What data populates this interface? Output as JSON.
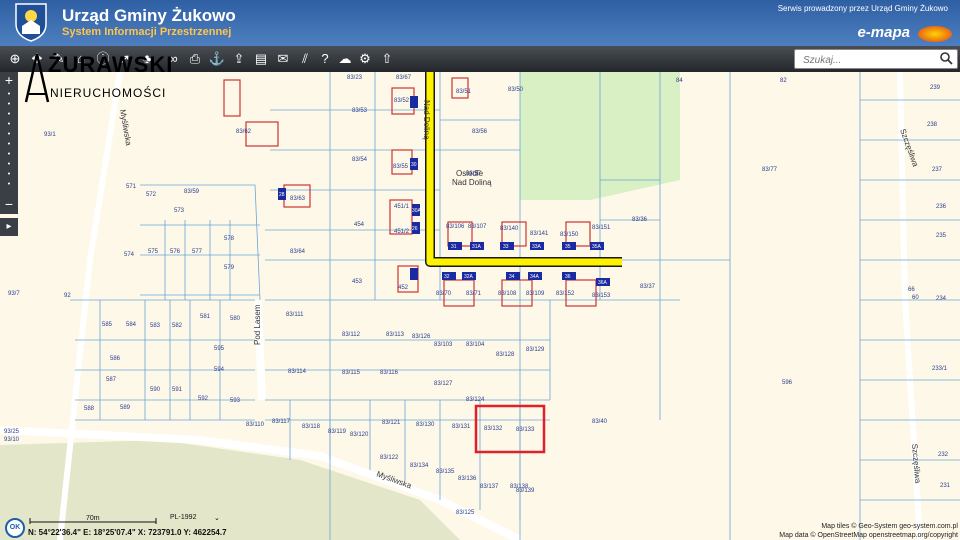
{
  "header": {
    "title": "Urząd Gminy Żukowo",
    "subtitle": "System Informacji Przestrzennej",
    "service_note": "Serwis prowadzony przez Urząd Gminy Żukowo",
    "emapa": "e-mapa"
  },
  "toolbar": {
    "tools": [
      "zoom-in-icon",
      "pan-icon",
      "measure-icon",
      "home-icon",
      "info-icon",
      "select-icon",
      "tree-icon",
      "link-icon",
      "print-icon",
      "anchor-icon",
      "export-icon",
      "layers-icon",
      "layout-icon",
      "comment-icon",
      "hatch-icon",
      "help-icon",
      "cloud-icon",
      "settings-icon",
      "share-icon"
    ],
    "search_placeholder": "Szukaj..."
  },
  "watermark": {
    "name": "ŻURAWSKI",
    "sub": "NIERUCHOMOŚCI"
  },
  "map": {
    "streets": [
      "Nad Doliną",
      "Pod Lasem",
      "Myśliwska",
      "Szczęśliwa"
    ],
    "settlement": [
      "Osiedle",
      "Nad Doliną"
    ],
    "highlight_parcel": [
      "83/132",
      "83/133"
    ],
    "parcels": {
      "p1": "83/23",
      "p2": "83/67",
      "p3": "83/51",
      "p4": "83/50",
      "p5": "84",
      "p6": "82",
      "p7": "239",
      "p8": "83/53",
      "p9": "83/52",
      "p10": "83/62",
      "p11": "93/1",
      "p12": "83/56",
      "p13": "83/54",
      "p14": "83/55",
      "p15": "83/57",
      "p16": "83/77",
      "p17": "237",
      "p18": "238",
      "p19": "571",
      "p20": "572",
      "p21": "83/59",
      "p22": "83/63",
      "p23": "573",
      "p24": "454",
      "p25": "451/1",
      "p26": "451/2",
      "p27": "83/106",
      "p28": "83/107",
      "p29": "83/140",
      "p30": "83/141",
      "p31": "83/150",
      "p32": "83/151",
      "p33": "83/36",
      "p34": "236",
      "p35": "235",
      "p36": "574",
      "p37": "575",
      "p38": "576",
      "p39": "577",
      "p40": "578",
      "p41": "579",
      "p42": "83/64",
      "p43": "453",
      "p44": "452",
      "p45": "83/70",
      "p46": "83/71",
      "p47": "83/108",
      "p48": "83/109",
      "p49": "83/152",
      "p50": "83/153",
      "p51": "83/37",
      "p52": "93/7",
      "p53": "92",
      "p54": "585",
      "p55": "584",
      "p56": "583",
      "p57": "582",
      "p58": "581",
      "p59": "580",
      "p60": "83/111",
      "p61": "83/112",
      "p62": "83/113",
      "p63": "83/126",
      "p64": "83/103",
      "p65": "83/104",
      "p66": "83/128",
      "p67": "83/129",
      "p68": "66",
      "p69": "234",
      "p70": "586",
      "p71": "595",
      "p72": "594",
      "p73": "587",
      "p74": "590",
      "p75": "591",
      "p76": "83/114",
      "p77": "83/115",
      "p78": "83/116",
      "p79": "83/127",
      "p80": "596",
      "p81": "233/1",
      "p82": "588",
      "p83": "589",
      "p84": "592",
      "p85": "593",
      "p86": "83/124",
      "p87": "83/110",
      "p88": "83/117",
      "p89": "83/118",
      "p90": "83/119",
      "p91": "83/120",
      "p92": "83/121",
      "p93": "83/130",
      "p94": "83/131",
      "p95": "83/40",
      "p96": "93/25",
      "p97": "93/10",
      "p98": "83/122",
      "p99": "83/134",
      "p100": "83/135",
      "p101": "83/136",
      "p102": "83/137",
      "p103": "83/138",
      "p104": "83/139",
      "p105": "83/125",
      "p106": "232",
      "p107": "231",
      "p108": "60"
    },
    "house_numbers": [
      "31",
      "31A",
      "33",
      "33A",
      "35",
      "35A",
      "32",
      "32A",
      "34",
      "34A",
      "36",
      "36A",
      "28",
      "30",
      "30A",
      "26"
    ]
  },
  "footer": {
    "ok": "OK",
    "scale_label": "70m",
    "crs": "PL-1992",
    "coords": "N: 54°22'36.4\"  E: 18°25'07.4\"  X: 723791.0  Y: 462254.7",
    "attrib1": "Map tiles © Geo-System geo-system.com.pl",
    "attrib2": "Map data © OpenStreetMap openstreetmap.org/copyright"
  }
}
